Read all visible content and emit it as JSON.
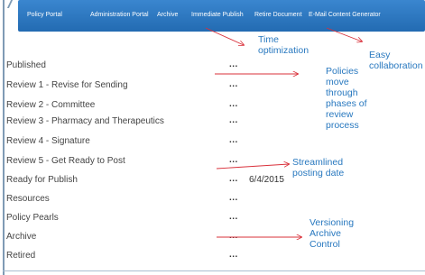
{
  "nav": {
    "items": [
      {
        "label": "Policy Portal"
      },
      {
        "label": "Administration Portal"
      },
      {
        "label": "Archive"
      },
      {
        "label": "Immediate Publish"
      },
      {
        "label": "Retire Document"
      },
      {
        "label": "E-Mail Content Generator"
      }
    ]
  },
  "rows": [
    {
      "label": "Published",
      "menu": "...",
      "date": ""
    },
    {
      "label": "Review 1 - Revise for Sending",
      "menu": "...",
      "date": ""
    },
    {
      "label": "Review 2 - Committee",
      "menu": "...",
      "date": ""
    },
    {
      "label": "Review 3 - Pharmacy and Therapeutics",
      "menu": "...",
      "date": ""
    },
    {
      "label": "Review 4 - Signature",
      "menu": "...",
      "date": ""
    },
    {
      "label": "Review 5 - Get Ready to Post",
      "menu": "...",
      "date": ""
    },
    {
      "label": "Ready for Publish",
      "menu": "...",
      "date": "6/4/2015"
    },
    {
      "label": "Resources",
      "menu": "...",
      "date": ""
    },
    {
      "label": "Policy Pearls",
      "menu": "...",
      "date": ""
    },
    {
      "label": "Archive",
      "menu": "...",
      "date": ""
    },
    {
      "label": "Retired",
      "menu": "...",
      "date": ""
    }
  ],
  "callouts": {
    "time": {
      "line1": "Time",
      "line2": "optimization"
    },
    "collab": {
      "line1": "Easy",
      "line2": "collaboration"
    },
    "phases": {
      "line1": "Policies",
      "line2": "move",
      "line3": "through",
      "line4": "phases of",
      "line5": "review",
      "line6": "process"
    },
    "posting": {
      "line1": "Streamlined",
      "line2": "posting date"
    },
    "versioning": {
      "line1": "Versioning",
      "line2": "Archive",
      "line3": "Control"
    }
  },
  "colors": {
    "nav_bg": "#2c73b7",
    "callout_text": "#2878bf",
    "arrow": "#d9303a",
    "row_text": "#444444"
  }
}
